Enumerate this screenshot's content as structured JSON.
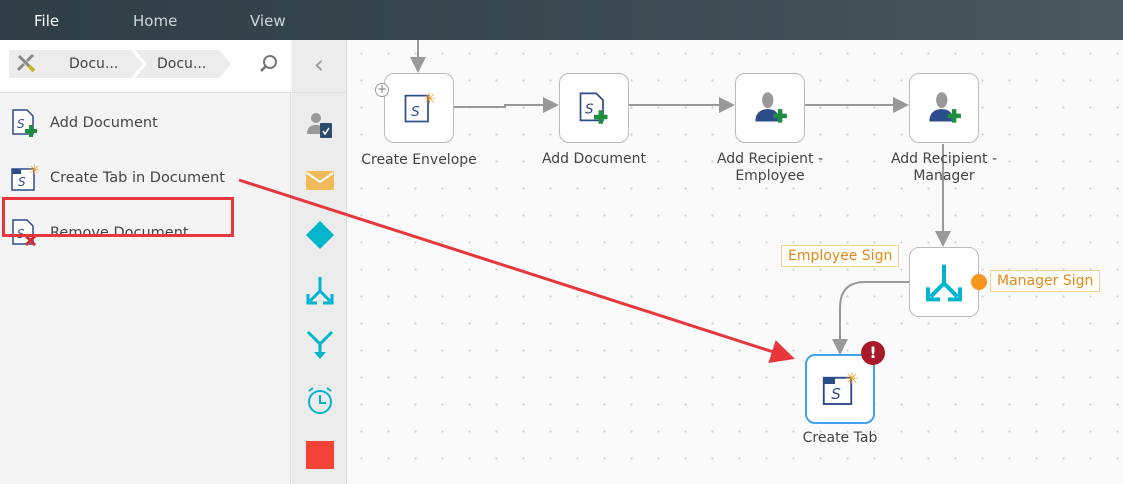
{
  "menu": {
    "file": "File",
    "home": "Home",
    "view": "View"
  },
  "breadcrumb": {
    "items": [
      "Docu...",
      "Docu..."
    ]
  },
  "palette": {
    "items": [
      {
        "label": "Add Document"
      },
      {
        "label": "Create Tab in Document"
      },
      {
        "label": "Remove Document"
      }
    ]
  },
  "nodes": {
    "create_envelope": "Create Envelope",
    "add_document": "Add Document",
    "add_recipient_employee": "Add Recipient -\nEmployee",
    "add_recipient_manager": "Add Recipient -\nManager",
    "create_tab": "Create Tab"
  },
  "branches": {
    "employee": "Employee Sign",
    "manager": "Manager Sign"
  },
  "colors": {
    "accent": "#00b5cc",
    "highlight": "#e8363c",
    "warning": "#a8192a",
    "branch": "#e08a1e"
  }
}
